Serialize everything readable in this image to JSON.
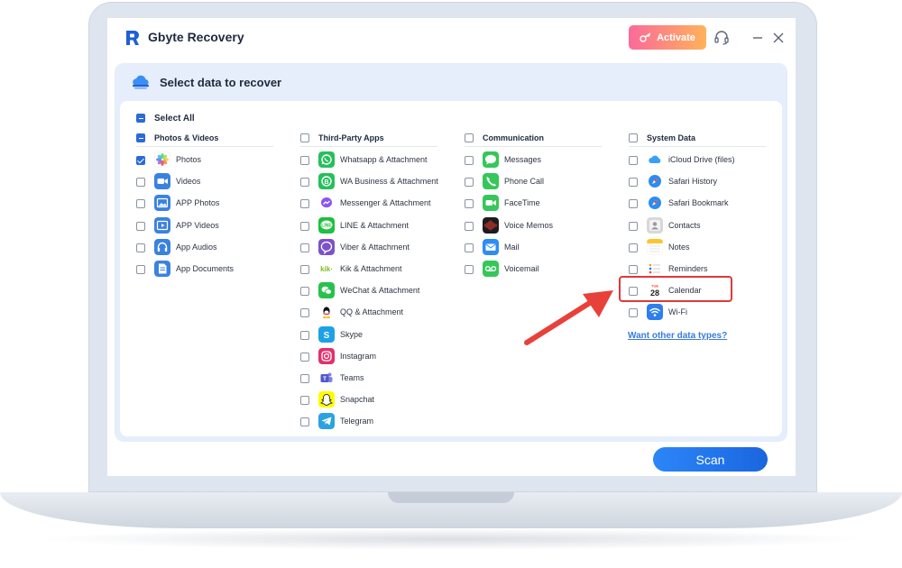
{
  "app": {
    "name": "Gbyte Recovery"
  },
  "titlebar": {
    "activate_label": "Activate"
  },
  "header": {
    "title": "Select data to recover"
  },
  "select_all": {
    "label": "Select All",
    "state": "partial"
  },
  "columns": [
    {
      "title": "Photos & Videos",
      "state": "partial",
      "items": [
        {
          "label": "Photos",
          "checked": true,
          "icon": "photos-icon",
          "color": "#ffffff"
        },
        {
          "label": "Videos",
          "checked": false,
          "icon": "videos-icon",
          "color": "#3b82e0"
        },
        {
          "label": "APP Photos",
          "checked": false,
          "icon": "app-photos-icon",
          "color": "#3b82e0"
        },
        {
          "label": "APP Videos",
          "checked": false,
          "icon": "app-videos-icon",
          "color": "#3b82e0"
        },
        {
          "label": "App Audios",
          "checked": false,
          "icon": "app-audios-icon",
          "color": "#3b82e0"
        },
        {
          "label": "App Documents",
          "checked": false,
          "icon": "app-documents-icon",
          "color": "#3b82e0"
        }
      ]
    },
    {
      "title": "Third-Party Apps",
      "state": "unchecked",
      "items": [
        {
          "label": "Whatsapp & Attachment",
          "checked": false,
          "icon": "whatsapp-icon",
          "color": "#25c05a"
        },
        {
          "label": "WA Business & Attachment",
          "checked": false,
          "icon": "whatsapp-business-icon",
          "color": "#25c05a"
        },
        {
          "label": "Messenger & Attachment",
          "checked": false,
          "icon": "messenger-icon",
          "color": "#8a54f5"
        },
        {
          "label": "LINE & Attachment",
          "checked": false,
          "icon": "line-icon",
          "color": "#1fbf3f"
        },
        {
          "label": "Viber & Attachment",
          "checked": false,
          "icon": "viber-icon",
          "color": "#7d52c8"
        },
        {
          "label": "Kik & Attachment",
          "checked": false,
          "icon": "kik-icon",
          "color": "#ffffff"
        },
        {
          "label": "WeChat & Attachment",
          "checked": false,
          "icon": "wechat-icon",
          "color": "#27c24c"
        },
        {
          "label": "QQ & Attachment",
          "checked": false,
          "icon": "qq-icon",
          "color": "#ffffff"
        },
        {
          "label": "Skype",
          "checked": false,
          "icon": "skype-icon",
          "color": "#1da1e6"
        },
        {
          "label": "Instagram",
          "checked": false,
          "icon": "instagram-icon",
          "color": "#e2306c"
        },
        {
          "label": "Teams",
          "checked": false,
          "icon": "teams-icon",
          "color": "#ffffff"
        },
        {
          "label": "Snapchat",
          "checked": false,
          "icon": "snapchat-icon",
          "color": "#fffc00"
        },
        {
          "label": "Telegram",
          "checked": false,
          "icon": "telegram-icon",
          "color": "#2aa3e0"
        }
      ]
    },
    {
      "title": "Communication",
      "state": "unchecked",
      "items": [
        {
          "label": "Messages",
          "checked": false,
          "icon": "messages-icon",
          "color": "#34c759"
        },
        {
          "label": "Phone Call",
          "checked": false,
          "icon": "phone-icon",
          "color": "#34c759"
        },
        {
          "label": "FaceTime",
          "checked": false,
          "icon": "facetime-icon",
          "color": "#34c759"
        },
        {
          "label": "Voice Memos",
          "checked": false,
          "icon": "voice-memos-icon",
          "color": "#1c1c1e"
        },
        {
          "label": "Mail",
          "checked": false,
          "icon": "mail-icon",
          "color": "#2f8cf5"
        },
        {
          "label": "Voicemail",
          "checked": false,
          "icon": "voicemail-icon",
          "color": "#34c759"
        }
      ]
    },
    {
      "title": "System Data",
      "state": "unchecked",
      "items": [
        {
          "label": "iCloud Drive (files)",
          "checked": false,
          "icon": "icloud-icon",
          "color": "#ffffff"
        },
        {
          "label": "Safari History",
          "checked": false,
          "icon": "safari-icon",
          "color": "#2d8cf0"
        },
        {
          "label": "Safari Bookmark",
          "checked": false,
          "icon": "safari-bookmark-icon",
          "color": "#2d8cf0"
        },
        {
          "label": "Contacts",
          "checked": false,
          "icon": "contacts-icon",
          "color": "#d8d8d8"
        },
        {
          "label": "Notes",
          "checked": false,
          "icon": "notes-icon",
          "color": "#ffffff"
        },
        {
          "label": "Reminders",
          "checked": false,
          "icon": "reminders-icon",
          "color": "#ffffff"
        },
        {
          "label": "Calendar",
          "checked": false,
          "icon": "calendar-icon",
          "color": "#ffffff",
          "icon_text_top": "TUE",
          "icon_text_num": "28"
        },
        {
          "label": "Wi-Fi",
          "checked": false,
          "icon": "wifi-icon",
          "color": "#2d7ff0"
        }
      ]
    }
  ],
  "other_types_link": "Want other data types?",
  "scan_label": "Scan",
  "colors": {
    "accent": "#2a6bd8",
    "highlight": "#e0393a",
    "panel_bg": "#e5eefa"
  }
}
